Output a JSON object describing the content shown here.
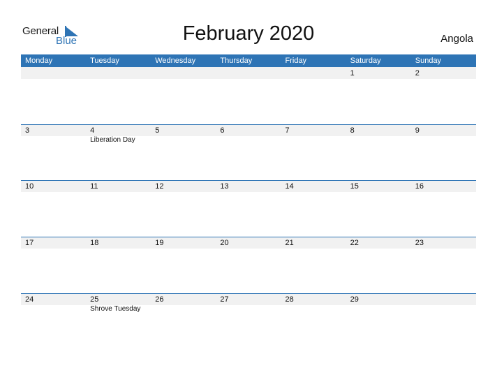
{
  "logo": {
    "word1": "General",
    "word2": "Blue",
    "accent_color": "#2e74b5"
  },
  "title": "February 2020",
  "country": "Angola",
  "header_color": "#2e74b5",
  "weekdays": [
    "Monday",
    "Tuesday",
    "Wednesday",
    "Thursday",
    "Friday",
    "Saturday",
    "Sunday"
  ],
  "weeks": [
    [
      {
        "day": ""
      },
      {
        "day": ""
      },
      {
        "day": ""
      },
      {
        "day": ""
      },
      {
        "day": ""
      },
      {
        "day": "1"
      },
      {
        "day": "2"
      }
    ],
    [
      {
        "day": "3"
      },
      {
        "day": "4",
        "event": "Liberation Day"
      },
      {
        "day": "5"
      },
      {
        "day": "6"
      },
      {
        "day": "7"
      },
      {
        "day": "8"
      },
      {
        "day": "9"
      }
    ],
    [
      {
        "day": "10"
      },
      {
        "day": "11"
      },
      {
        "day": "12"
      },
      {
        "day": "13"
      },
      {
        "day": "14"
      },
      {
        "day": "15"
      },
      {
        "day": "16"
      }
    ],
    [
      {
        "day": "17"
      },
      {
        "day": "18"
      },
      {
        "day": "19"
      },
      {
        "day": "20"
      },
      {
        "day": "21"
      },
      {
        "day": "22"
      },
      {
        "day": "23"
      }
    ],
    [
      {
        "day": "24"
      },
      {
        "day": "25",
        "event": "Shrove Tuesday"
      },
      {
        "day": "26"
      },
      {
        "day": "27"
      },
      {
        "day": "28"
      },
      {
        "day": "29"
      },
      {
        "day": ""
      }
    ]
  ]
}
